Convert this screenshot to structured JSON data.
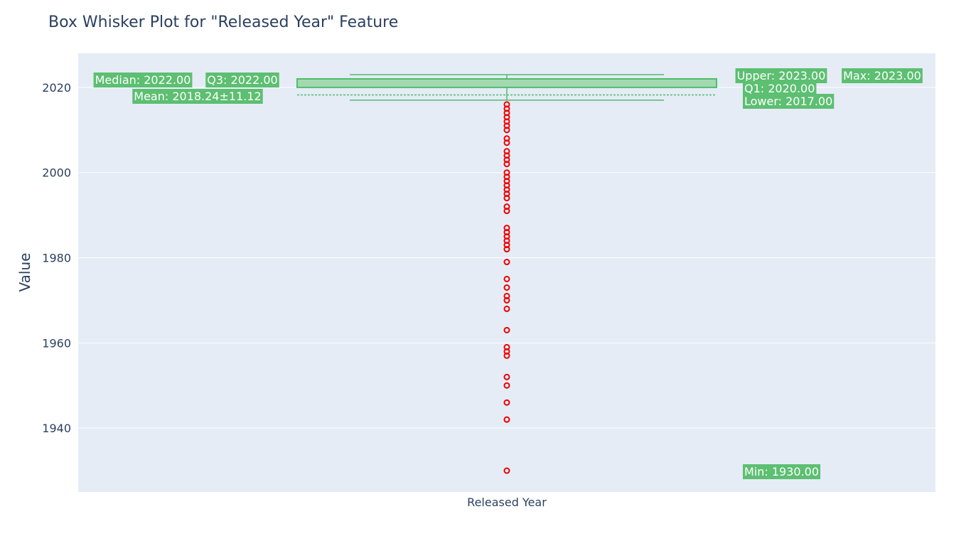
{
  "chart_data": {
    "type": "box",
    "title": "Box Whisker Plot for \"Released Year\" Feature",
    "xlabel": "",
    "ylabel": "Value",
    "categories": [
      "Released Year"
    ],
    "ylim": [
      1925,
      2028
    ],
    "yticks": [
      1940,
      1960,
      1980,
      2000,
      2020
    ],
    "grid": true,
    "stats": {
      "min": 1930,
      "lower_fence": 2017,
      "q1": 2020,
      "median": 2022,
      "q3": 2022,
      "upper_fence": 2023,
      "max": 2023,
      "mean": 2018.24,
      "std": 11.12
    },
    "outliers": [
      2016,
      2015,
      2014,
      2013,
      2012,
      2011,
      2010,
      2008,
      2007,
      2005,
      2004,
      2003,
      2002,
      2000,
      1999,
      1998,
      1997,
      1996,
      1995,
      1994,
      1992,
      1991,
      1987,
      1986,
      1985,
      1984,
      1983,
      1982,
      1979,
      1975,
      1973,
      1971,
      1970,
      1968,
      1963,
      1959,
      1958,
      1957,
      1952,
      1950,
      1946,
      1942,
      1930
    ],
    "colors": {
      "box_line": "#4fbd6a",
      "box_fill": "#a3d9b1",
      "outlier": "#ee0000",
      "annotation_bg": "#5cbf71",
      "plot_bg": "#e5ecf6",
      "text": "#2a3f5f"
    },
    "annotations": [
      {
        "key": "median",
        "text": "Median: 2022.00"
      },
      {
        "key": "q3",
        "text": "Q3: 2022.00"
      },
      {
        "key": "mean",
        "text": "Mean: 2018.24±11.12"
      },
      {
        "key": "upper",
        "text": "Upper: 2023.00"
      },
      {
        "key": "max",
        "text": "Max: 2023.00"
      },
      {
        "key": "q1",
        "text": "Q1: 2020.00"
      },
      {
        "key": "lower",
        "text": "Lower: 2017.00"
      },
      {
        "key": "min",
        "text": "Min: 1930.00"
      }
    ]
  }
}
